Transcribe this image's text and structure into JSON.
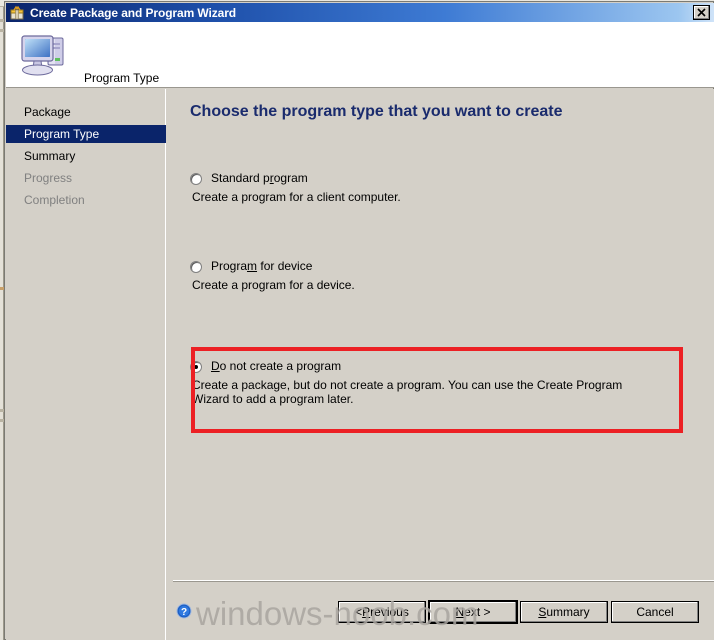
{
  "window": {
    "title": "Create Package and Program Wizard",
    "title_icon": "package-wizard-icon",
    "close_label": "✕"
  },
  "header": {
    "title": "Program Type",
    "icon": "computer-icon"
  },
  "sidebar": {
    "items": [
      {
        "label": "Package",
        "state": "done"
      },
      {
        "label": "Program Type",
        "state": "active"
      },
      {
        "label": "Summary",
        "state": "done"
      },
      {
        "label": "Progress",
        "state": "disabled"
      },
      {
        "label": "Completion",
        "state": "disabled"
      }
    ]
  },
  "content": {
    "heading": "Choose the program type that you want to create",
    "options": [
      {
        "label_pre": "Standard p",
        "label_accel": "r",
        "label_post": "ogram",
        "description": "Create a program for a client computer.",
        "selected": false
      },
      {
        "label_pre": "Progra",
        "label_accel": "m",
        "label_post": " for device",
        "description": "Create a program for a device.",
        "selected": false
      },
      {
        "label_pre": "",
        "label_accel": "D",
        "label_post": "o not create a program",
        "description": "Create a package, but do not create a program. You can use the Create Program Wizard to add a program later.",
        "selected": true
      }
    ]
  },
  "annotation": {
    "highlight_color": "#ec2024"
  },
  "footer": {
    "help_icon": "help-question-icon",
    "buttons": [
      {
        "pre": "< ",
        "accel": "P",
        "post": "revious",
        "default": false
      },
      {
        "pre": "",
        "accel": "N",
        "post": "ext >",
        "default": true
      },
      {
        "pre": "",
        "accel": "S",
        "post": "ummary",
        "default": false
      },
      {
        "pre": "Cancel",
        "accel": "",
        "post": "",
        "default": false
      }
    ]
  },
  "watermark": {
    "text": "windows-noob.com"
  },
  "colors": {
    "title_bar_start": "#0a246a",
    "dialog_face": "#d4d0c8",
    "heading_blue": "#1a2b6d",
    "nav_active": "#0a246a",
    "highlight_red": "#ec2024"
  }
}
